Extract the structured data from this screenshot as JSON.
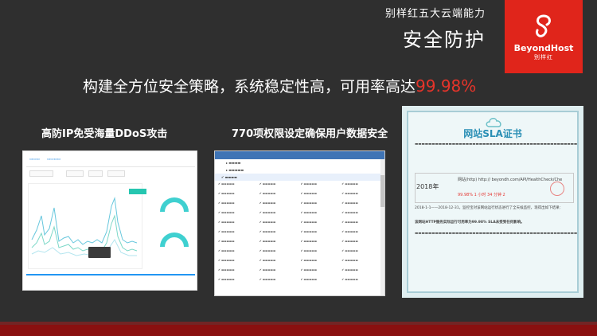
{
  "header": {
    "subtitle": "别样红五大云端能力",
    "title": "安全防护"
  },
  "logo": {
    "name": "BeyondHost",
    "name_cn": "别样红",
    "brand_color": "#e0251b"
  },
  "headline": {
    "text": "构建全方位安全策略，系统稳定性高，可用率高达",
    "value": "99.98%",
    "accent_color": "#e6342a"
  },
  "cards": {
    "ddos": {
      "title": "高防IP免受海量DDoS攻击"
    },
    "permissions": {
      "title": "770项权限设定确保用户数据安全"
    },
    "sla": {
      "heading": "网站SLA证书",
      "year": "2018年",
      "url": "网站(http)  http://        beyondh.com/API/HealthCheck/Che",
      "values_row": "99.98%        1 小时 34 分钟      2",
      "period_text": "2018-1-1——2018-12-31，监控宝对该网站运行状态进行了全天候监控，现得出如下结果：",
      "result_text": "该网站HTTP服务实际运行可用率为99.98% SLA未受到任何影响。"
    }
  }
}
